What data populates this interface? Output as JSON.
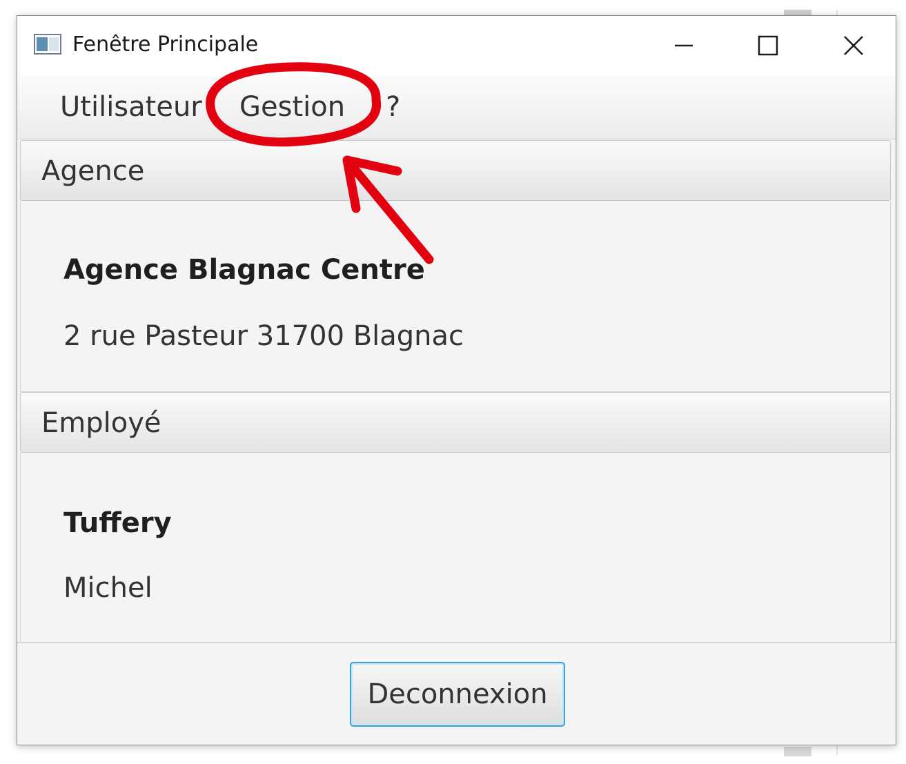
{
  "window": {
    "title": "Fenêtre Principale"
  },
  "menu": {
    "items": [
      {
        "label": "Utilisateur"
      },
      {
        "label": "Gestion"
      },
      {
        "label": "?"
      }
    ]
  },
  "agence": {
    "header": "Agence",
    "name": "Agence Blagnac Centre",
    "address": "2 rue Pasteur 31700 Blagnac"
  },
  "employe": {
    "header": "Employé",
    "last_name": "Tuffery",
    "first_name": "Michel"
  },
  "footer": {
    "logout_label": "Deconnexion"
  },
  "colors": {
    "annotation": "#e3000f",
    "button_focus": "#3aa0d8"
  }
}
